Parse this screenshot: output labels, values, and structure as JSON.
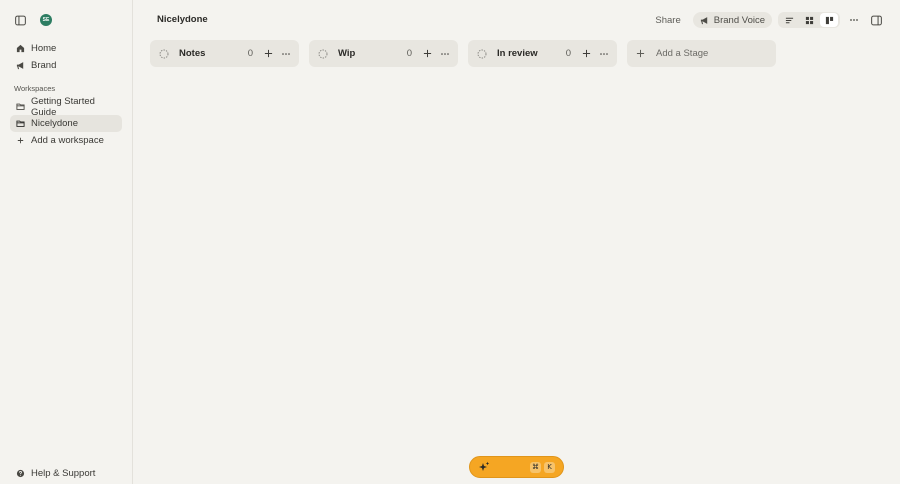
{
  "sidebar": {
    "avatar_initials": "SE",
    "avatar_color": "#2d7d62",
    "nav": [
      {
        "label": "Home",
        "icon": "home-icon"
      },
      {
        "label": "Brand",
        "icon": "megaphone-icon"
      }
    ],
    "workspaces_label": "Workspaces",
    "workspaces": [
      {
        "label": "Getting Started Guide",
        "icon": "folder-icon"
      },
      {
        "label": "Nicelydone",
        "icon": "folder-icon",
        "active": true
      },
      {
        "label": "Add a workspace",
        "icon": "plus-icon"
      }
    ],
    "help_label": "Help & Support"
  },
  "header": {
    "title": "Nicelydone",
    "share_label": "Share",
    "brand_voice_label": "Brand Voice",
    "active_view": "board"
  },
  "board": {
    "stages": [
      {
        "name": "Notes",
        "count": "0"
      },
      {
        "name": "Wip",
        "count": "0"
      },
      {
        "name": "In review",
        "count": "0"
      }
    ],
    "add_stage_label": "Add a Stage"
  },
  "ai_bar": {
    "key1": "⌘",
    "key2": "K",
    "accent": "#f5a623"
  }
}
